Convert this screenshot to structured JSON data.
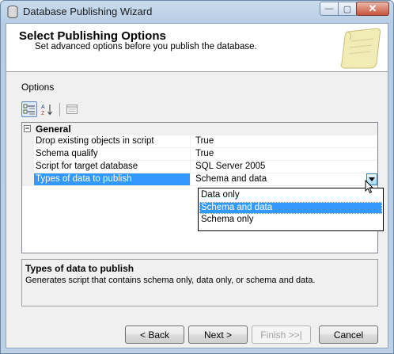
{
  "window": {
    "title": "Database Publishing Wizard",
    "close_glyph": "✕",
    "min_glyph": "—",
    "max_glyph": "▢"
  },
  "header": {
    "title": "Select Publishing Options",
    "subtitle": "Set advanced options before you publish the database."
  },
  "options_label": "Options",
  "toolbar": {
    "buttons": [
      {
        "icon": "categorized-icon"
      },
      {
        "icon": "alphabetical-icon"
      },
      {
        "icon": "property-pages-icon"
      }
    ]
  },
  "grid": {
    "category": {
      "toggle": "−",
      "label": "General"
    },
    "rows": [
      {
        "name": "Drop existing objects in script",
        "value": "True"
      },
      {
        "name": "Schema qualify",
        "value": "True"
      },
      {
        "name": "Script for target database",
        "value": "SQL Server 2005"
      },
      {
        "name": "Types of data to publish",
        "value": "Schema and data"
      }
    ],
    "dropdown_options": [
      "Data only",
      "Schema and data",
      "Schema only"
    ],
    "dropdown_selected": "Schema and data"
  },
  "description": {
    "title": "Types of data to publish",
    "text": "Generates script that contains schema only, data only, or schema and data."
  },
  "buttons": {
    "back": "< Back",
    "next": "Next >",
    "finish": "Finish >>|",
    "cancel": "Cancel"
  },
  "colors": {
    "selection": "#3399ff",
    "frame": "#bcd0e6"
  }
}
